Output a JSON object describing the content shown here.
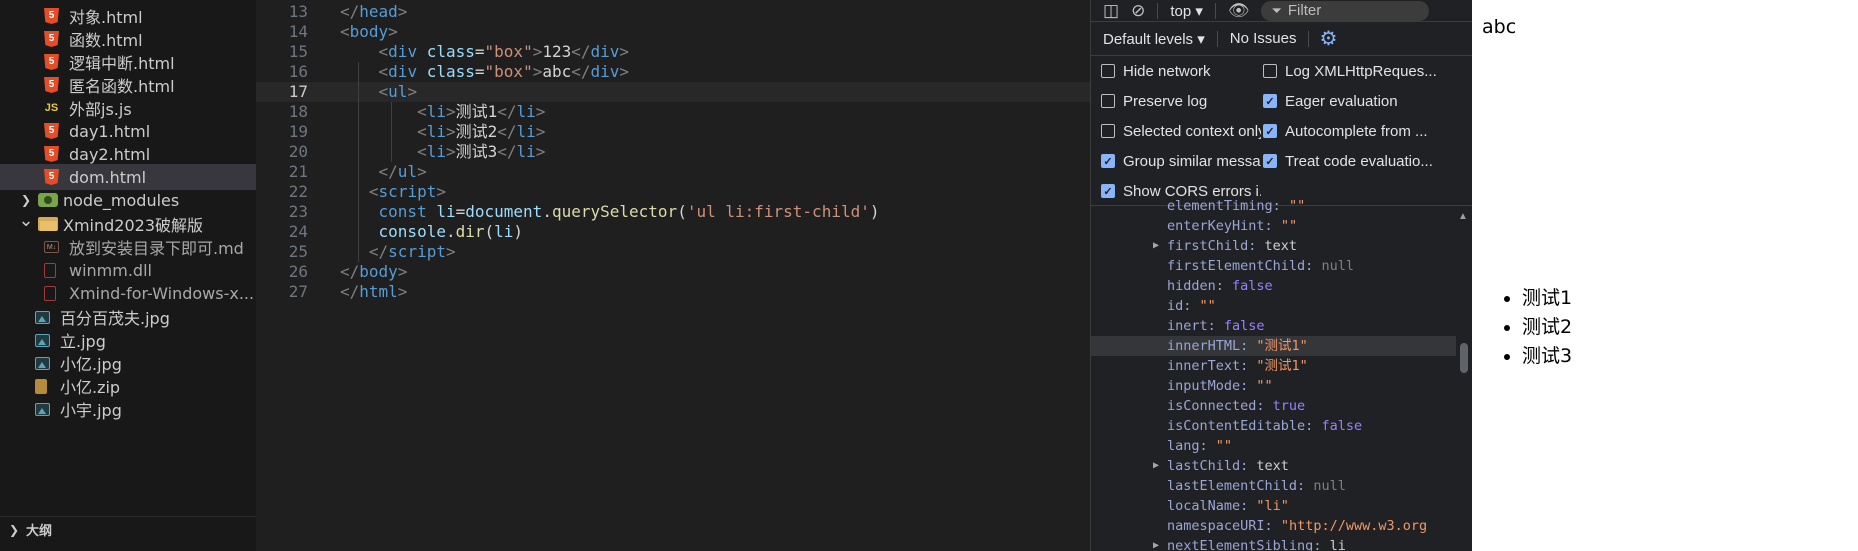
{
  "explorer": {
    "files": [
      {
        "label": "对象.html",
        "icon": "html5-icon"
      },
      {
        "label": "函数.html",
        "icon": "html5-icon"
      },
      {
        "label": "逻辑中断.html",
        "icon": "html5-icon"
      },
      {
        "label": "匿名函数.html",
        "icon": "html5-icon"
      },
      {
        "label": "外部js.js",
        "icon": "js-icon",
        "icon_text": "JS"
      },
      {
        "label": "day1.html",
        "icon": "html5-icon"
      },
      {
        "label": "day2.html",
        "icon": "html5-icon"
      },
      {
        "label": "dom.html",
        "icon": "html5-icon"
      },
      {
        "label": "node_modules",
        "icon": "node-folder-icon"
      },
      {
        "label": "Xmind2023破解版",
        "icon": "folder-open-icon"
      },
      {
        "label": "放到安装目录下即可.md",
        "icon": "markdown-icon",
        "icon_text": "M↓"
      },
      {
        "label": "winmm.dll",
        "icon": "dll-file-icon"
      },
      {
        "label": "Xmind-for-Windows-x...",
        "icon": "dll-file-icon"
      },
      {
        "label": "百分百茂夫.jpg",
        "icon": "image-icon"
      },
      {
        "label": "立.jpg",
        "icon": "image-icon"
      },
      {
        "label": "小亿.jpg",
        "icon": "image-icon"
      },
      {
        "label": "小亿.zip",
        "icon": "zip-icon"
      },
      {
        "label": "小宇.jpg",
        "icon": "image-icon"
      }
    ],
    "html_icon_text": "5",
    "outline_label": "大纲"
  },
  "editor": {
    "lines": [
      {
        "n": "13",
        "t": [
          [
            "</",
            "punc"
          ],
          [
            "head",
            "tag"
          ],
          [
            ">",
            "punc"
          ]
        ]
      },
      {
        "n": "14",
        "t": [
          [
            "<",
            "punc"
          ],
          [
            "body",
            "tag"
          ],
          [
            ">",
            "punc"
          ]
        ]
      },
      {
        "n": "15",
        "t": [
          [
            "    ",
            "txt"
          ],
          [
            "<",
            "punc"
          ],
          [
            "div",
            "tag"
          ],
          [
            " ",
            "txt"
          ],
          [
            "class",
            "attr"
          ],
          [
            "=",
            "txt"
          ],
          [
            "\"box\"",
            "str"
          ],
          [
            ">",
            "punc"
          ],
          [
            "123",
            "txt"
          ],
          [
            "</",
            "punc"
          ],
          [
            "div",
            "tag"
          ],
          [
            ">",
            "punc"
          ]
        ]
      },
      {
        "n": "16",
        "t": [
          [
            "    ",
            "txt"
          ],
          [
            "<",
            "punc"
          ],
          [
            "div",
            "tag"
          ],
          [
            " ",
            "txt"
          ],
          [
            "class",
            "attr"
          ],
          [
            "=",
            "txt"
          ],
          [
            "\"box\"",
            "str"
          ],
          [
            ">",
            "punc"
          ],
          [
            "abc",
            "txt"
          ],
          [
            "</",
            "punc"
          ],
          [
            "div",
            "tag"
          ],
          [
            ">",
            "punc"
          ]
        ]
      },
      {
        "n": "17",
        "t": [
          [
            "    ",
            "txt"
          ],
          [
            "<",
            "punc"
          ],
          [
            "ul",
            "tag"
          ],
          [
            ">",
            "punc"
          ]
        ]
      },
      {
        "n": "18",
        "t": [
          [
            "        ",
            "txt"
          ],
          [
            "<",
            "punc"
          ],
          [
            "li",
            "tag"
          ],
          [
            ">",
            "punc"
          ],
          [
            "测试1",
            "txt"
          ],
          [
            "</",
            "punc"
          ],
          [
            "li",
            "tag"
          ],
          [
            ">",
            "punc"
          ]
        ]
      },
      {
        "n": "19",
        "t": [
          [
            "        ",
            "txt"
          ],
          [
            "<",
            "punc"
          ],
          [
            "li",
            "tag"
          ],
          [
            ">",
            "punc"
          ],
          [
            "测试2",
            "txt"
          ],
          [
            "</",
            "punc"
          ],
          [
            "li",
            "tag"
          ],
          [
            ">",
            "punc"
          ]
        ]
      },
      {
        "n": "20",
        "t": [
          [
            "        ",
            "txt"
          ],
          [
            "<",
            "punc"
          ],
          [
            "li",
            "tag"
          ],
          [
            ">",
            "punc"
          ],
          [
            "测试3",
            "txt"
          ],
          [
            "</",
            "punc"
          ],
          [
            "li",
            "tag"
          ],
          [
            ">",
            "punc"
          ]
        ]
      },
      {
        "n": "21",
        "t": [
          [
            "    ",
            "txt"
          ],
          [
            "</",
            "punc"
          ],
          [
            "ul",
            "tag"
          ],
          [
            ">",
            "punc"
          ]
        ]
      },
      {
        "n": "22",
        "t": [
          [
            "   ",
            "txt"
          ],
          [
            "<",
            "punc"
          ],
          [
            "script",
            "tag"
          ],
          [
            ">",
            "punc"
          ]
        ]
      },
      {
        "n": "23",
        "t": [
          [
            "    ",
            "txt"
          ],
          [
            "const",
            "kw"
          ],
          [
            " ",
            "txt"
          ],
          [
            "li",
            "var"
          ],
          [
            "=",
            "txt"
          ],
          [
            "document",
            "var"
          ],
          [
            ".",
            "txt"
          ],
          [
            "querySelector",
            "fn"
          ],
          [
            "(",
            "txt"
          ],
          [
            "'ul li:first-child'",
            "str"
          ],
          [
            ")",
            "txt"
          ]
        ]
      },
      {
        "n": "24",
        "t": [
          [
            "    ",
            "txt"
          ],
          [
            "console",
            "var"
          ],
          [
            ".",
            "txt"
          ],
          [
            "dir",
            "fn"
          ],
          [
            "(",
            "txt"
          ],
          [
            "li",
            "var"
          ],
          [
            ")",
            "txt"
          ]
        ]
      },
      {
        "n": "25",
        "t": [
          [
            "   ",
            "txt"
          ],
          [
            "</",
            "punc"
          ],
          [
            "script",
            "tag"
          ],
          [
            ">",
            "punc"
          ]
        ]
      },
      {
        "n": "26",
        "t": [
          [
            "</",
            "punc"
          ],
          [
            "body",
            "tag"
          ],
          [
            ">",
            "punc"
          ]
        ]
      },
      {
        "n": "27",
        "t": [
          [
            "</",
            "punc"
          ],
          [
            "html",
            "tag"
          ],
          [
            ">",
            "punc"
          ]
        ]
      }
    ],
    "active_line": "17"
  },
  "devtools": {
    "context": "top ▾",
    "filter_placeholder": "Filter",
    "levels": "Default levels ▾",
    "issues": "No Issues",
    "settings": [
      {
        "label": "Hide network",
        "checked": false
      },
      {
        "label": "Log XMLHttpReques...",
        "checked": false
      },
      {
        "label": "Preserve log",
        "checked": false
      },
      {
        "label": "Eager evaluation",
        "checked": true
      },
      {
        "label": "Selected context only",
        "checked": false
      },
      {
        "label": "Autocomplete from ...",
        "checked": true
      },
      {
        "label": "Group similar messa...",
        "checked": true
      },
      {
        "label": "Treat code evaluatio...",
        "checked": true
      },
      {
        "label": "Show CORS errors i...",
        "checked": true
      }
    ],
    "properties": [
      {
        "key": "elementTiming",
        "value": "\"\"",
        "kind": "str",
        "expand": false
      },
      {
        "key": "enterKeyHint",
        "value": "\"\"",
        "kind": "str",
        "expand": false
      },
      {
        "key": "firstChild",
        "value": "text",
        "kind": "obj",
        "expand": true
      },
      {
        "key": "firstElementChild",
        "value": "null",
        "kind": "null",
        "expand": false
      },
      {
        "key": "hidden",
        "value": "false",
        "kind": "bool",
        "expand": false
      },
      {
        "key": "id",
        "value": "\"\"",
        "kind": "str",
        "expand": false
      },
      {
        "key": "inert",
        "value": "false",
        "kind": "bool",
        "expand": false
      },
      {
        "key": "innerHTML",
        "value": "\"测试1\"",
        "kind": "str",
        "expand": false,
        "highlight": true
      },
      {
        "key": "innerText",
        "value": "\"测试1\"",
        "kind": "str",
        "expand": false
      },
      {
        "key": "inputMode",
        "value": "\"\"",
        "kind": "str",
        "expand": false
      },
      {
        "key": "isConnected",
        "value": "true",
        "kind": "bool",
        "expand": false
      },
      {
        "key": "isContentEditable",
        "value": "false",
        "kind": "bool",
        "expand": false
      },
      {
        "key": "lang",
        "value": "\"\"",
        "kind": "str",
        "expand": false
      },
      {
        "key": "lastChild",
        "value": "text",
        "kind": "obj",
        "expand": true
      },
      {
        "key": "lastElementChild",
        "value": "null",
        "kind": "null",
        "expand": false
      },
      {
        "key": "localName",
        "value": "\"li\"",
        "kind": "str",
        "expand": false
      },
      {
        "key": "namespaceURI",
        "value": "\"http://www.w3.org",
        "kind": "str",
        "expand": false
      },
      {
        "key": "nextElementSibling",
        "value": "li",
        "kind": "obj",
        "expand": true
      }
    ]
  },
  "preview": {
    "box_text": "abc",
    "list_items": [
      "测试1",
      "测试2",
      "测试3"
    ]
  },
  "colors": {
    "sidebar_bg": "#181818",
    "editor_bg": "#1f1f1f",
    "devtools_bg": "#202124",
    "checkbox_checked": "#8ab4f8",
    "preview_bg": "#ffffff"
  }
}
